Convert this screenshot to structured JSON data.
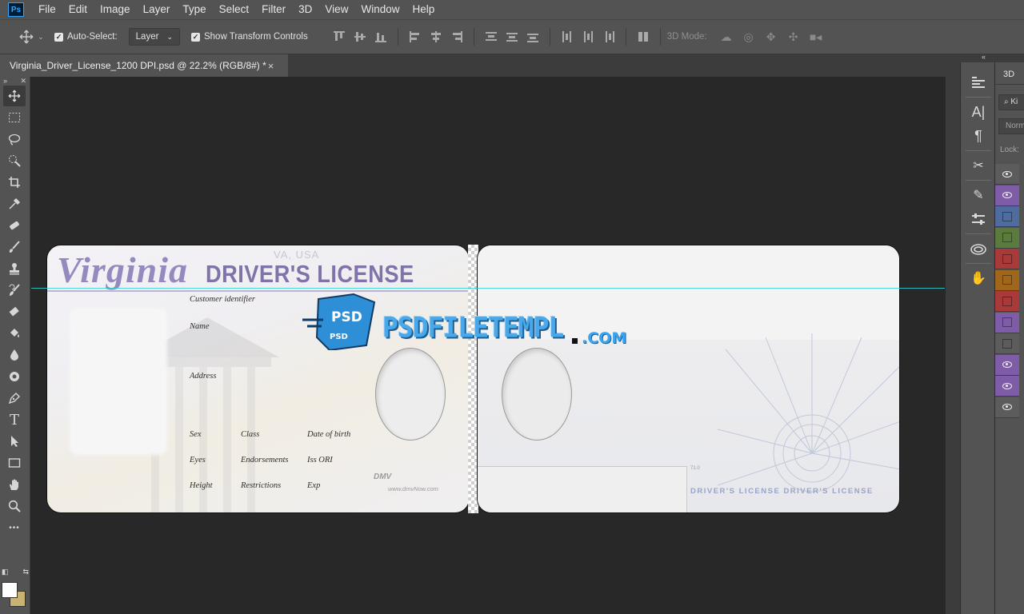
{
  "app": {
    "logo": "Ps"
  },
  "menu": [
    "File",
    "Edit",
    "Image",
    "Layer",
    "Type",
    "Select",
    "Filter",
    "3D",
    "View",
    "Window",
    "Help"
  ],
  "options": {
    "auto_select_label": "Auto-Select:",
    "auto_select_checked": true,
    "auto_select_target": "Layer",
    "show_transform_label": "Show Transform Controls",
    "show_transform_checked": true,
    "mode_3d_label": "3D Mode:"
  },
  "document_tab": {
    "title": "Virginia_Driver_License_1200 DPI.psd @ 22.2% (RGB/8#) *",
    "close": "×"
  },
  "toolbox": {
    "tools": [
      "move-tool",
      "rectangular-marquee-tool",
      "lasso-tool",
      "quick-selection-tool",
      "crop-tool",
      "eyedropper-tool",
      "spot-healing-brush-tool",
      "brush-tool",
      "clone-stamp-tool",
      "history-brush-tool",
      "eraser-tool",
      "paint-bucket-tool",
      "blur-tool",
      "dodge-tool",
      "pen-tool",
      "type-tool",
      "path-selection-tool",
      "rectangle-tool",
      "hand-tool",
      "zoom-tool",
      "more-tools"
    ],
    "type_tool_glyph": "T",
    "more_glyph": "•••",
    "foreground_color": "#ffffff",
    "background_color": "#c8b375"
  },
  "canvas": {
    "front": {
      "state": "Virginia",
      "title": "DRIVER'S LICENSE",
      "region": "VA, USA",
      "labels": {
        "customer_id": "Customer identifier",
        "name": "Name",
        "address": "Address",
        "sex": "Sex",
        "class": "Class",
        "dob": "Date of birth",
        "eyes": "Eyes",
        "endorsements": "Endorsements",
        "iss": "Iss ORI",
        "height": "Height",
        "restrictions": "Restrictions",
        "exp": "Exp"
      },
      "brand": "DMV",
      "brand_url": "www.dmvNow.com"
    },
    "back": {
      "footer_text": "DRIVER'S LICENSE DRIVER'S LICENSE",
      "number": "71.0"
    },
    "watermark": {
      "badge_top": "PSD",
      "badge_bottom": "PSD",
      "text": "PSDFILETEMPL",
      "suffix": ".COM"
    }
  },
  "panels": {
    "collapse_glyph": "«",
    "layers_tab": "3D",
    "search": "Ki",
    "blend": "Norm",
    "lock": "Lock:",
    "layers": [
      {
        "color": "",
        "visible": true
      },
      {
        "color": "#7e5ca8",
        "visible": true
      },
      {
        "color": "#4f6c9e",
        "visible": false
      },
      {
        "color": "#5a7a3e",
        "visible": false
      },
      {
        "color": "#a83a3a",
        "visible": false
      },
      {
        "color": "#a0661c",
        "visible": false
      },
      {
        "color": "#a83a3a",
        "visible": false
      },
      {
        "color": "#7e5ca8",
        "visible": false
      },
      {
        "color": "",
        "visible": false
      },
      {
        "color": "#7e5ca8",
        "visible": true
      },
      {
        "color": "#7e5ca8",
        "visible": true
      },
      {
        "color": "",
        "visible": true
      }
    ]
  }
}
